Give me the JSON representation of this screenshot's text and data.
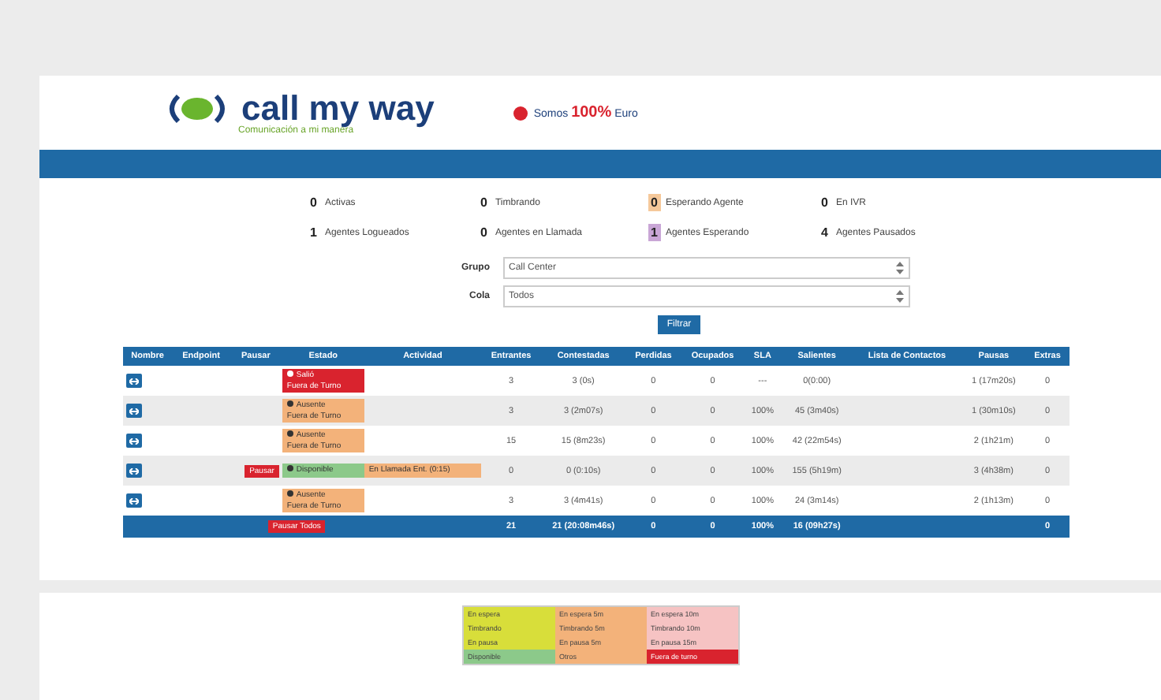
{
  "header": {
    "logo_text": "call my way",
    "tagline": "Comunicación a mi manera",
    "promo_prefix": "Somos",
    "promo_highlight": "100%",
    "promo_suffix": "Euro"
  },
  "counters": [
    {
      "value": "0",
      "label": "Activas",
      "color": "#ffffff"
    },
    {
      "value": "0",
      "label": "Timbrando",
      "color": "#ffffff"
    },
    {
      "value": "0",
      "label": "Esperando Agente",
      "color": "#f5c89a"
    },
    {
      "value": "0",
      "label": "En IVR",
      "color": "#ffffff"
    },
    {
      "value": "1",
      "label": "Agentes Logueados",
      "color": "#ffffff"
    },
    {
      "value": "0",
      "label": "Agentes en Llamada",
      "color": "#ffffff"
    },
    {
      "value": "1",
      "label": "Agentes Esperando",
      "color": "#c9a6d6"
    },
    {
      "value": "4",
      "label": "Agentes Pausados",
      "color": "#ffffff"
    }
  ],
  "filters": [
    {
      "label": "Grupo",
      "value": "Call Center"
    },
    {
      "label": "Cola",
      "value": "Todos"
    }
  ],
  "filter_button": "Filtrar",
  "table": {
    "columns": [
      "Nombre",
      "Endpoint",
      "Pausar",
      "Estado",
      "Actividad",
      "Entrantes",
      "Contestadas",
      "Perdidas",
      "Ocupados",
      "SLA",
      "Salientes",
      "Lista de Contactos",
      "Pausas",
      "Extras"
    ],
    "rows": [
      {
        "status": {
          "text": "Salió",
          "subtext": "Fuera de Turno",
          "color": "#d9232e"
        },
        "values": {
          "entrantes": "3",
          "contestadas": "3 (0s)",
          "perdidas": "0",
          "ocupados": "0",
          "sla": "---",
          "salientes": "0(0:00)",
          "pausas": "1 (17m20s)",
          "extras": "0"
        }
      },
      {
        "status": {
          "text": "Ausente",
          "subtext": "Fuera de Turno",
          "color": "#f3b27a"
        },
        "values": {
          "entrantes": "3",
          "contestadas": "3 (2m07s)",
          "perdidas": "0",
          "ocupados": "0",
          "sla": "100%",
          "salientes": "45 (3m40s)",
          "pausas": "1 (30m10s)",
          "extras": "0"
        }
      },
      {
        "status": {
          "text": "Ausente",
          "subtext": "Fuera de Turno",
          "color": "#f3b27a"
        },
        "values": {
          "entrantes": "15",
          "contestadas": "15 (8m23s)",
          "perdidas": "0",
          "ocupados": "0",
          "sla": "100%",
          "salientes": "42 (22m54s)",
          "pausas": "2 (1h21m)",
          "extras": "0"
        }
      },
      {
        "pause_button": "Pausar",
        "status": {
          "text": "Disponible",
          "color": "#8cc98a"
        },
        "activity": {
          "text": "En Llamada Ent. (0:15)",
          "color": "#f3b27a"
        },
        "values": {
          "entrantes": "0",
          "contestadas": "0 (0:10s)",
          "perdidas": "0",
          "ocupados": "0",
          "sla": "100%",
          "salientes": "155 (5h19m)",
          "pausas": "3 (4h38m)",
          "extras": "0"
        }
      },
      {
        "status": {
          "text": "Ausente",
          "subtext": "Fuera de Turno",
          "color": "#f3b27a"
        },
        "values": {
          "entrantes": "3",
          "contestadas": "3 (4m41s)",
          "perdidas": "0",
          "ocupados": "0",
          "sla": "100%",
          "salientes": "24 (3m14s)",
          "pausas": "2 (1h13m)",
          "extras": "0"
        }
      }
    ],
    "total": {
      "pause_all": "Pausar Todos",
      "values": {
        "entrantes": "21",
        "contestadas": "21 (20:08m46s)",
        "perdidas": "0",
        "ocupados": "0",
        "sla": "100%",
        "salientes": "16 (09h27s)",
        "extras": "0"
      }
    }
  },
  "legend": [
    {
      "text": "En espera",
      "color": "#d8de3a"
    },
    {
      "text": "En espera 5m",
      "color": "#f3b27a"
    },
    {
      "text": "En espera 10m",
      "color": "#f6c3c3"
    },
    {
      "text": "Timbrando",
      "color": "#d8de3a"
    },
    {
      "text": "Timbrando 5m",
      "color": "#f3b27a"
    },
    {
      "text": "Timbrando 10m",
      "color": "#f6c3c3"
    },
    {
      "text": "En pausa",
      "color": "#d8de3a"
    },
    {
      "text": "En pausa 5m",
      "color": "#f3b27a"
    },
    {
      "text": "En pausa 15m",
      "color": "#f6c3c3"
    },
    {
      "text": "Disponible",
      "color": "#8cc98a"
    },
    {
      "text": "Otros",
      "color": "#f3b27a"
    },
    {
      "text": "Fuera de turno",
      "color": "#d9232e"
    }
  ]
}
